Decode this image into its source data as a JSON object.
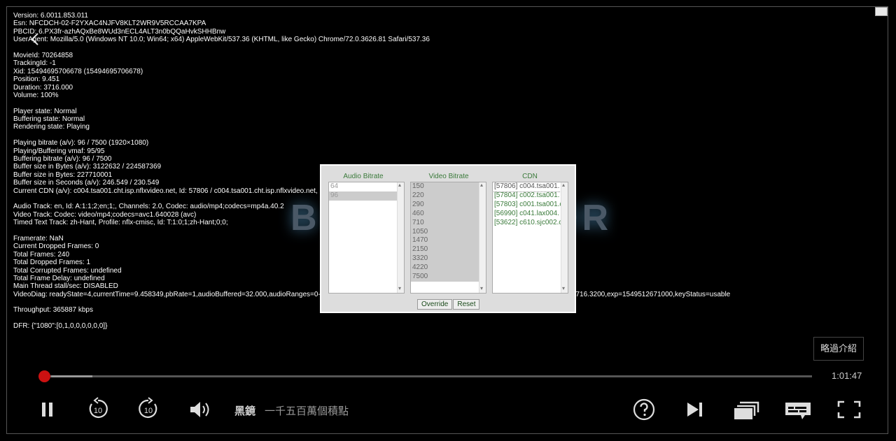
{
  "diagnostics": [
    "Version: 6.0011.853.011",
    "Esn: NFCDCH-02-F2YXAC4NJFV8KLT2WR9V5RCCAA7KPA",
    "PBCID: 6.PX3fr-azhAQxBe8WUd3nECL4ALT3n0bQQaHvkSHHBnw",
    "UserAgent: Mozilla/5.0 (Windows NT 10.0; Win64; x64) AppleWebKit/537.36 (KHTML, like Gecko) Chrome/72.0.3626.81 Safari/537.36",
    "",
    "MovieId: 70264858",
    "TrackingId: -1",
    "Xid: 15494695706678 (15494695706678)",
    "Position: 9.451",
    "Duration: 3716.000",
    "Volume: 100%",
    "",
    "Player state: Normal",
    "Buffering state: Normal",
    "Rendering state: Playing",
    "",
    "Playing bitrate (a/v): 96 / 7500 (1920×1080)",
    "Playing/Buffering vmaf: 95/95",
    "Buffering bitrate (a/v): 96 / 7500",
    "Buffer size in Bytes (a/v): 3122632 / 224587369",
    "Buffer size in Bytes: 227710001",
    "Buffer size in Seconds (a/v): 246.549 / 230.549",
    "Current CDN (a/v): c004.tsa001.cht.isp.nflxvideo.net, Id: 57806 / c004.tsa001.cht.isp.nflxvideo.net, Id:",
    "",
    "Audio Track: en, Id: A:1:1;2;en;1;, Channels: 2.0, Codec: audio/mp4;codecs=mp4a.40.2",
    "Video Track: Codec: video/mp4;codecs=avc1.640028 (avc)",
    "Timed Text Track: zh-Hant, Profile: nflx-cmisc, Id: T:1:0;1;zh-Hant;0;0;",
    "",
    "Framerate: NaN",
    "Current Dropped Frames: 0",
    "Total Frames: 240",
    "Total Dropped Frames: 1",
    "Total Corrupted Frames: undefined",
    "Total Frame Delay: undefined",
    "Main Thread stall/sec: DISABLED",
    "VideoDiag: readyState=4,currentTime=9.458349,pbRate=1,audioBuffered=32.000,audioRanges=0-31.999999,videoBuffered=24.000,videoRanges                                                      3716.3200,exp=1549512671000,keyStatus=usable",
    "",
    "Throughput: 365887 kbps",
    "",
    "DFR: {\"1080\":[0,1,0,0,0,0,0,0]}"
  ],
  "background_title": {
    "left": "B",
    "right": "OR"
  },
  "panel": {
    "audio": {
      "heading": "Audio Bitrate",
      "items": [
        "64",
        "96"
      ]
    },
    "video": {
      "heading": "Video Bitrate",
      "items": [
        "150",
        "220",
        "290",
        "460",
        "710",
        "1050",
        "1470",
        "2150",
        "3320",
        "4220",
        "7500"
      ]
    },
    "cdn": {
      "heading": "CDN",
      "items": [
        "[57806] c004.tsa001.",
        "[57804] c002.tsa001.",
        "[57803] c001.tsa001.c",
        "[56990] c041.lax004.",
        "[53622] c610.sjc002.c"
      ]
    },
    "override_label": "Override",
    "reset_label": "Reset"
  },
  "player": {
    "skip_intro_label": "略過介紹",
    "time_remaining": "1:01:47",
    "progress_fraction": 0.0025,
    "buffer_fraction": 0.065,
    "show_title": "黑鏡",
    "episode_title": "一千五百萬個積點",
    "replay_seconds": "10",
    "forward_seconds": "10"
  },
  "colors": {
    "progress_thumb": "#cc1111",
    "panel_heading": "#3a7a3a"
  }
}
